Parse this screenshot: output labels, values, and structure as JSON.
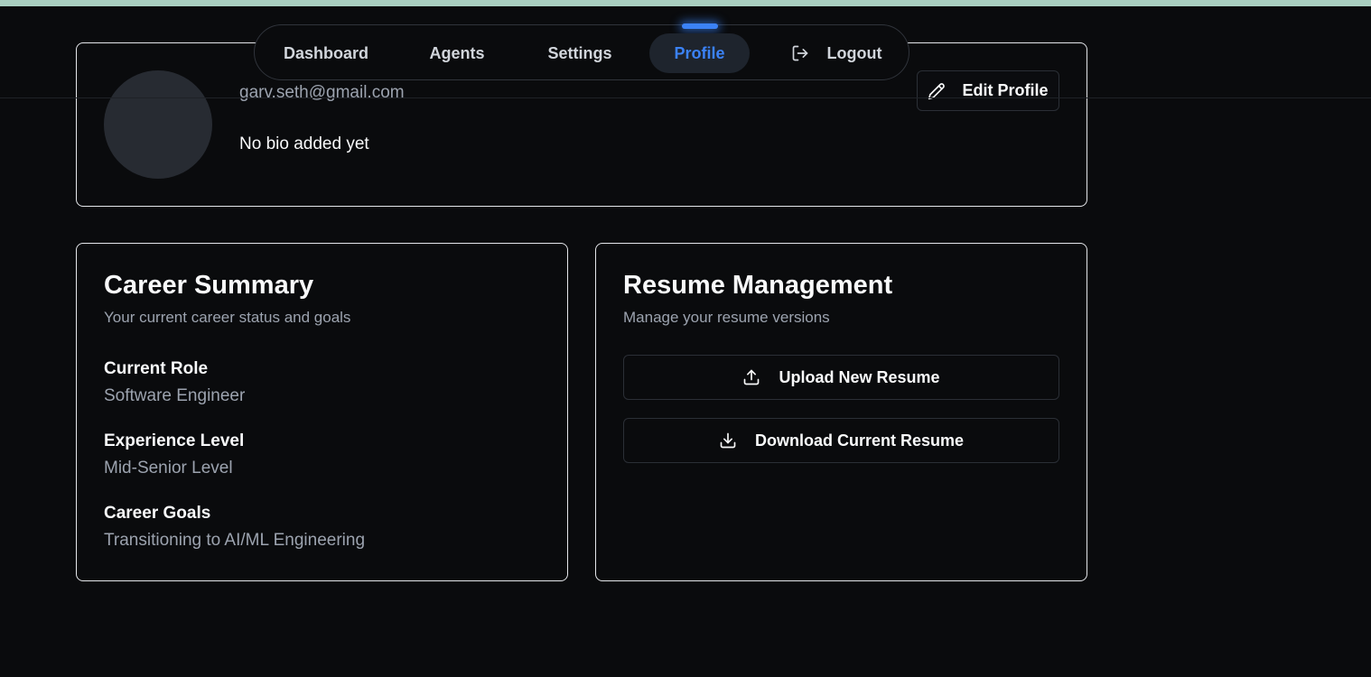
{
  "nav": {
    "items": [
      {
        "label": "Dashboard",
        "active": false
      },
      {
        "label": "Agents",
        "active": false
      },
      {
        "label": "Settings",
        "active": false
      },
      {
        "label": "Profile",
        "active": true
      },
      {
        "label": "Logout",
        "active": false,
        "icon": "logout-icon"
      }
    ]
  },
  "profile": {
    "email": "garv.seth@gmail.com",
    "bio": "No bio added yet",
    "edit_label": "Edit Profile",
    "edit_icon": "pencil-icon"
  },
  "career": {
    "title": "Career Summary",
    "subtitle": "Your current career status and goals",
    "fields": [
      {
        "label": "Current Role",
        "value": "Software Engineer"
      },
      {
        "label": "Experience Level",
        "value": "Mid-Senior Level"
      },
      {
        "label": "Career Goals",
        "value": "Transitioning to AI/ML Engineering"
      }
    ]
  },
  "resume": {
    "title": "Resume Management",
    "subtitle": "Manage your resume versions",
    "upload_label": "Upload New Resume",
    "upload_icon": "upload-icon",
    "download_label": "Download Current Resume",
    "download_icon": "download-icon"
  },
  "colors": {
    "accent": "#3b82f6",
    "background": "#0a0b0d",
    "top_strip": "#a9cfc0"
  }
}
